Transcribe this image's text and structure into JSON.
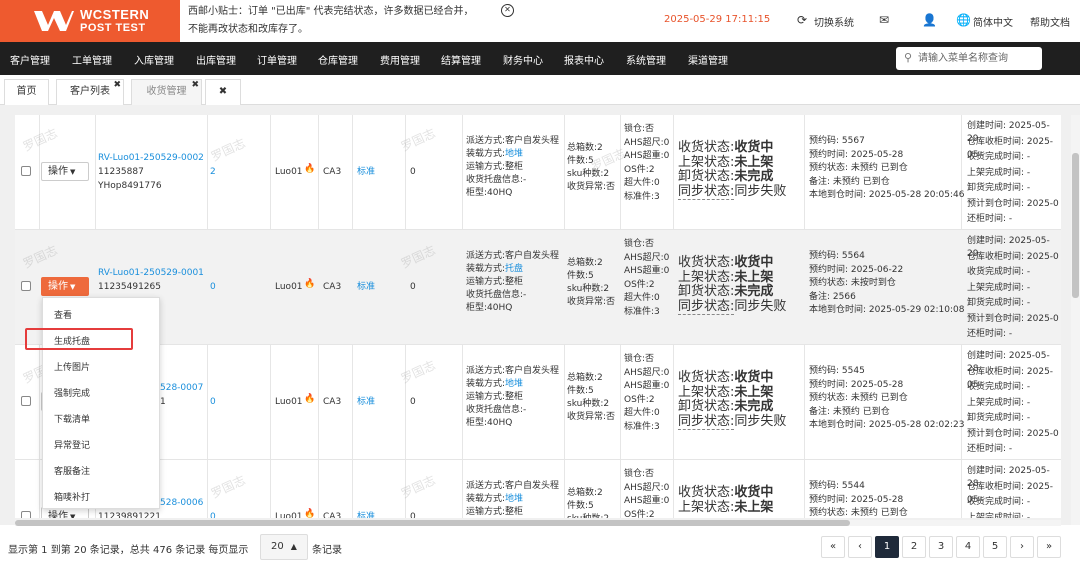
{
  "header": {
    "logo_line1": "WCSTERN",
    "logo_line2": "POST TEST",
    "notice_line1": "西邮小贴士：订单 \"已出库\" 代表完结状态，许多数据已经合并，",
    "notice_line2": "不能再改状态和改库存了。",
    "datetime": "2025-05-29 17:11:15",
    "switch_system": "切换系统",
    "language": "简体中文",
    "help": "帮助文档"
  },
  "nav": {
    "items": [
      "客户管理",
      "工单管理",
      "入库管理",
      "出库管理",
      "订单管理",
      "仓库管理",
      "费用管理",
      "结算管理",
      "财务中心",
      "报表中心",
      "系统管理",
      "渠道管理"
    ],
    "search_placeholder": "请输入菜单名称查询"
  },
  "tabs": [
    {
      "label": "首页"
    },
    {
      "label": "客户列表"
    },
    {
      "label": "收货管理"
    },
    {
      "label": ""
    }
  ],
  "watermark": "罗国志",
  "rows": [
    {
      "action": "操作",
      "code": "RV-Luo01-250529-0002",
      "line2": "11235887",
      "line3": "YHop8491776",
      "count": "2",
      "customer": "Luo01",
      "warehouse": "CA3",
      "type": "标准",
      "qty": "0",
      "shipping": [
        "派送方式:客户自发头程",
        "装载方式:",
        "运输方式:整柜",
        "收货托盘信息:-",
        "柜型:40HQ"
      ],
      "loading_value": "地堆",
      "boxes": [
        "总箱数:2",
        "件数:5",
        "sku种数:2",
        "收货异常:否"
      ],
      "flags": [
        "锁仓:否",
        "AHS超尺:0",
        "AHS超重:0",
        "OS件:2",
        "超大件:0",
        "标准件:3"
      ],
      "status": [
        {
          "label": "收货状态:",
          "value": "收货中"
        },
        {
          "label": "上架状态:",
          "value": "未上架"
        },
        {
          "label": "卸货状态:",
          "value": "未完成"
        },
        {
          "label": "同步状态:",
          "value": "同步失败"
        }
      ],
      "appt": [
        "预约码: 5567",
        "预约时间: 2025-05-28",
        "预约状态: 未预约 已到仓",
        "备注: 未预约 已到仓",
        "本地到仓时间: 2025-05-28 20:05:46"
      ],
      "times": [
        "创建时间: 2025-05-29",
        "仓库收柜时间: 2025-05-",
        "收货完成时间: -",
        "上架完成时间: -",
        "卸货完成时间: -",
        "预计到仓时间: 2025-0",
        "还柜时间: -"
      ]
    },
    {
      "action": "操作",
      "code": "RV-Luo01-250529-0001",
      "line2": "11235491265",
      "line3": "",
      "count": "0",
      "customer": "Luo01",
      "warehouse": "CA3",
      "type": "标准",
      "qty": "0",
      "shipping": [
        "派送方式:客户自发头程",
        "装载方式:",
        "运输方式:整柜",
        "收货托盘信息:-",
        "柜型:40HQ"
      ],
      "loading_value": "托盘",
      "boxes": [
        "总箱数:2",
        "件数:5",
        "sku种数:2",
        "收货异常:否"
      ],
      "flags": [
        "锁仓:否",
        "AHS超尺:0",
        "AHS超重:0",
        "OS件:2",
        "超大件:0",
        "标准件:3"
      ],
      "status": [
        {
          "label": "收货状态:",
          "value": "收货中"
        },
        {
          "label": "上架状态:",
          "value": "未上架"
        },
        {
          "label": "卸货状态:",
          "value": "未完成"
        },
        {
          "label": "同步状态:",
          "value": "同步失败"
        }
      ],
      "appt": [
        "预约码: 5564",
        "预约时间: 2025-06-22",
        "预约状态: 未按时到仓",
        "备注: 2566",
        "本地到仓时间: 2025-05-29 02:10:08"
      ],
      "times": [
        "创建时间: 2025-05-29",
        "仓库收柜时间: 2025-0",
        "收货完成时间: -",
        "上架完成时间: -",
        "卸货完成时间: -",
        "预计到仓时间: 2025-0",
        "还柜时间: -"
      ]
    },
    {
      "action": "操作",
      "code": "528-0007",
      "line2": "1",
      "line3": "",
      "count": "0",
      "customer": "Luo01",
      "warehouse": "CA3",
      "type": "标准",
      "qty": "0",
      "shipping": [
        "派送方式:客户自发头程",
        "装载方式:",
        "运输方式:整柜",
        "收货托盘信息:-",
        "柜型:40HQ"
      ],
      "loading_value": "地堆",
      "boxes": [
        "总箱数:2",
        "件数:5",
        "sku种数:2",
        "收货异常:否"
      ],
      "flags": [
        "锁仓:否",
        "AHS超尺:0",
        "AHS超重:0",
        "OS件:2",
        "超大件:0",
        "标准件:3"
      ],
      "status": [
        {
          "label": "收货状态:",
          "value": "收货中"
        },
        {
          "label": "上架状态:",
          "value": "未上架"
        },
        {
          "label": "卸货状态:",
          "value": "未完成"
        },
        {
          "label": "同步状态:",
          "value": "同步失败"
        }
      ],
      "appt": [
        "预约码: 5545",
        "预约时间: 2025-05-28",
        "预约状态: 未预约 已到仓",
        "备注: 未预约 已到仓",
        "本地到仓时间: 2025-05-28 02:02:23"
      ],
      "times": [
        "创建时间: 2025-05-28",
        "仓库收柜时间: 2025-05-",
        "收货完成时间: -",
        "上架完成时间: -",
        "卸货完成时间: -",
        "预计到仓时间: 2025-0",
        "还柜时间: -"
      ]
    },
    {
      "action": "操作",
      "code": "528-0006",
      "line2": "11239891221",
      "line3": "",
      "count": "0",
      "customer": "Luo01",
      "warehouse": "CA3",
      "type": "标准",
      "qty": "0",
      "shipping": [
        "派送方式:客户自发头程",
        "装载方式:",
        "运输方式:整柜"
      ],
      "loading_value": "地堆",
      "boxes": [
        "总箱数:2",
        "件数:5",
        "sku种数:2"
      ],
      "flags": [
        "锁仓:否",
        "AHS超尺:0",
        "AHS超重:0",
        "OS件:2"
      ],
      "status": [
        {
          "label": "收货状态:",
          "value": "收货中"
        },
        {
          "label": "上架状态:",
          "value": "未上架"
        }
      ],
      "appt": [
        "预约码: 5544",
        "预约时间: 2025-05-28",
        "预约状态: 未预约 已到仓"
      ],
      "times": [
        "创建时间: 2025-05-28",
        "仓库收柜时间: 2025-05-",
        "收货完成时间: -",
        "上架完成时间: -",
        "卸货完成时间: -"
      ]
    }
  ],
  "dropdown": [
    "查看",
    "生成托盘",
    "上传图片",
    "强制完成",
    "下载清单",
    "异常登记",
    "客服备注",
    "箱唛补打"
  ],
  "footer": {
    "info": "显示第 1 到第 20 条记录，总共 476 条记录 每页显示",
    "page_size": "20",
    "suffix": "条记录",
    "pages": [
      "«",
      "‹",
      "1",
      "2",
      "3",
      "4",
      "5",
      "›",
      "»"
    ],
    "current_page": "1"
  }
}
